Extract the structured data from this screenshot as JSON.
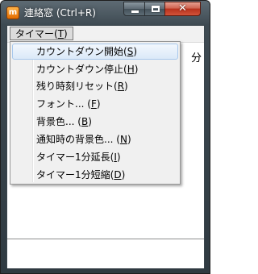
{
  "window": {
    "title": "連絡窓 (Ctrl+R)",
    "app_icon_letter": "m",
    "close_glyph": "✕"
  },
  "menubar": {
    "timer_menu": {
      "label": "タイマー(",
      "mnemonic": "T",
      "suffix": ")"
    }
  },
  "display": {
    "partial_text": "分"
  },
  "dropdown": {
    "items": [
      {
        "label": "カウントダウン開始(",
        "mnemonic": "S",
        "suffix": ")",
        "highlighted": true
      },
      {
        "label": "カウントダウン停止(",
        "mnemonic": "H",
        "suffix": ")"
      },
      {
        "label": "残り時刻リセット(",
        "mnemonic": "R",
        "suffix": ")"
      },
      {
        "label": "フォント... (",
        "mnemonic": "F",
        "suffix": ")"
      },
      {
        "label": "背景色... (",
        "mnemonic": "B",
        "suffix": ")"
      },
      {
        "label": "通知時の背景色... (",
        "mnemonic": "N",
        "suffix": ")"
      },
      {
        "label": "タイマー1分延長(",
        "mnemonic": "I",
        "suffix": ")"
      },
      {
        "label": "タイマー1分短縮(",
        "mnemonic": "D",
        "suffix": ")"
      }
    ]
  }
}
